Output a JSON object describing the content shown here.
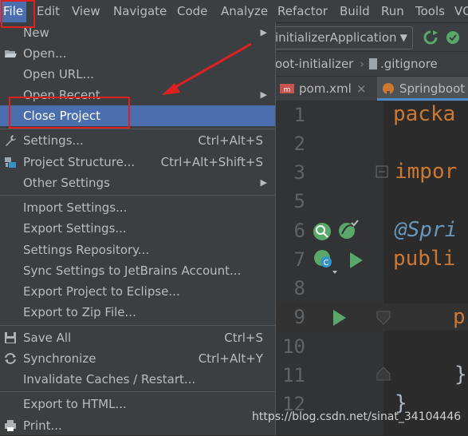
{
  "menubar": {
    "items": [
      "File",
      "Edit",
      "View",
      "Navigate",
      "Code",
      "Analyze",
      "Refactor",
      "Build",
      "Run",
      "Tools",
      "VCS"
    ],
    "active": "File"
  },
  "toolbar": {
    "run_config": "initializerApplication"
  },
  "nav": {
    "crumbs": [
      "oot-initializer",
      ".gitignore"
    ]
  },
  "tabs": [
    {
      "label": "pom.xml",
      "close": "×"
    },
    {
      "label": "Springboot"
    }
  ],
  "file_menu": {
    "items": [
      {
        "label": "New",
        "submenu": true
      },
      {
        "label": "Open...",
        "icon": "folder-open-icon"
      },
      {
        "label": "Open URL..."
      },
      {
        "label": "Open Recent",
        "submenu": true
      },
      {
        "label": "Close Project",
        "selected": true
      },
      {
        "label": "Settings...",
        "shortcut": "Ctrl+Alt+S",
        "icon": "wrench-icon"
      },
      {
        "label": "Project Structure...",
        "shortcut": "Ctrl+Alt+Shift+S",
        "icon": "project-structure-icon"
      },
      {
        "label": "Other Settings",
        "submenu": true
      },
      {
        "label": "Import Settings..."
      },
      {
        "label": "Export Settings..."
      },
      {
        "label": "Settings Repository..."
      },
      {
        "label": "Sync Settings to JetBrains Account..."
      },
      {
        "label": "Export Project to Eclipse..."
      },
      {
        "label": "Export to Zip File..."
      },
      {
        "label": "Save All",
        "shortcut": "Ctrl+S",
        "icon": "save-icon"
      },
      {
        "label": "Synchronize",
        "shortcut": "Ctrl+Alt+Y",
        "icon": "sync-icon"
      },
      {
        "label": "Invalidate Caches / Restart..."
      },
      {
        "label": "Export to HTML..."
      },
      {
        "label": "Print...",
        "icon": "print-icon"
      }
    ]
  },
  "editor": {
    "line_numbers": [
      "1",
      "2",
      "3",
      "5",
      "6",
      "7",
      "8",
      "9",
      "10",
      "11",
      "12"
    ],
    "lines": {
      "l1": "packa",
      "l3": "impor",
      "l6": "@Spri",
      "l7": "publi",
      "l9": "p",
      "l11": "}",
      "l12": "}"
    }
  },
  "watermark": "https://blog.csdn.net/sinat_34104446",
  "colors": {
    "accent": "#4b6eaf",
    "annotation_red": "#e02020",
    "keyword": "#cc7832",
    "annotation_blue": "#6897bb"
  }
}
